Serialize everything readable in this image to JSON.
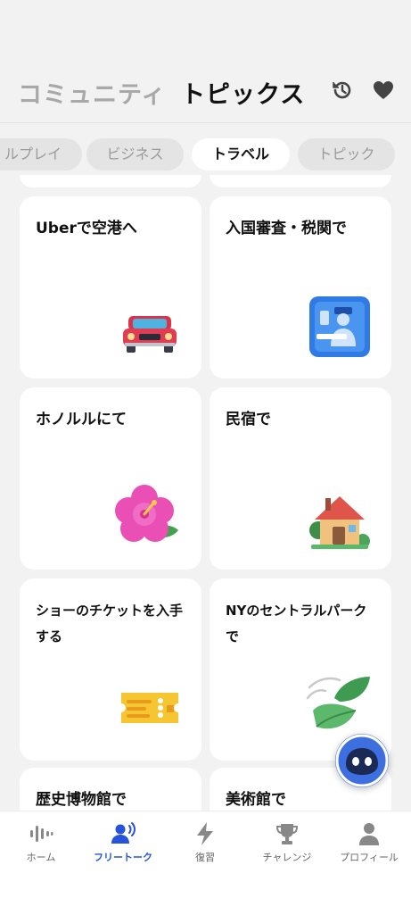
{
  "header": {
    "tabs": [
      {
        "label": "コミュニティ",
        "active": false
      },
      {
        "label": "トピックス",
        "active": true
      }
    ],
    "icons": [
      "history-icon",
      "heart-icon"
    ]
  },
  "chips": [
    {
      "label": "ルプレイ",
      "active": false
    },
    {
      "label": "ビジネス",
      "active": false
    },
    {
      "label": "トラベル",
      "active": true
    },
    {
      "label": "トピック",
      "active": false
    }
  ],
  "cards": [
    {
      "title": "Uberで空港へ",
      "icon": "car-icon"
    },
    {
      "title": "入国審査・税関で",
      "icon": "customs-officer-icon"
    },
    {
      "title": "ホノルルにて",
      "icon": "hibiscus-icon"
    },
    {
      "title": "民宿で",
      "icon": "house-icon"
    },
    {
      "title": "ショーのチケットを入手する",
      "icon": "ticket-icon"
    },
    {
      "title": "NYのセントラルパークで",
      "icon": "leaves-icon"
    },
    {
      "title": "歴史博物館で",
      "icon": ""
    },
    {
      "title": "美術館で",
      "icon": ""
    }
  ],
  "bottom_nav": [
    {
      "label": "ホーム",
      "icon": "soundwave-icon",
      "active": false
    },
    {
      "label": "フリートーク",
      "icon": "speaking-person-icon",
      "active": true
    },
    {
      "label": "復習",
      "icon": "lightning-icon",
      "active": false
    },
    {
      "label": "チャレンジ",
      "icon": "trophy-icon",
      "active": false
    },
    {
      "label": "プロフィール",
      "icon": "person-icon",
      "active": false
    }
  ],
  "colors": {
    "background": "#f2f2f2",
    "card": "#ffffff",
    "accent": "#2653d9",
    "inactive_text": "#a8a8a8"
  }
}
